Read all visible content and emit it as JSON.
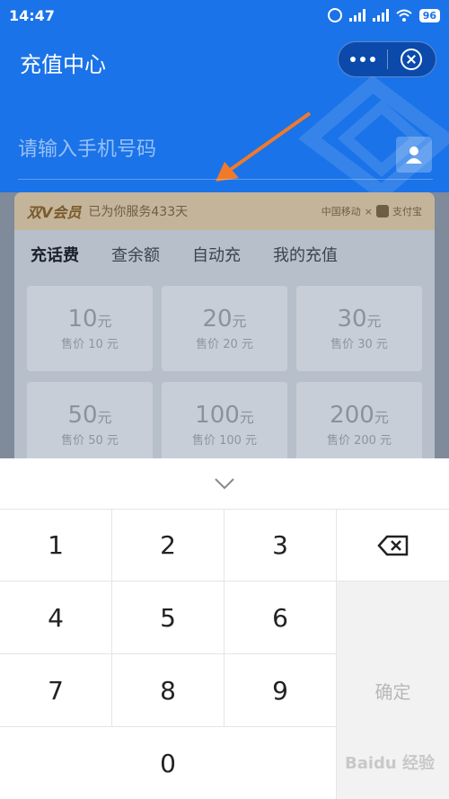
{
  "status_bar": {
    "time": "14:47",
    "battery": "96"
  },
  "header": {
    "title": "充值中心",
    "phone_placeholder": "请输入手机号码"
  },
  "vip": {
    "title": "双V会员",
    "text": "已为你服务433天",
    "brand": "中国移动",
    "separator": "×",
    "partner": "支付宝"
  },
  "tabs": [
    {
      "label": "充话费"
    },
    {
      "label": "查余额"
    },
    {
      "label": "自动充"
    },
    {
      "label": "我的充值"
    }
  ],
  "products": [
    {
      "face": "10",
      "unit": "元",
      "price": "售价 10 元"
    },
    {
      "face": "20",
      "unit": "元",
      "price": "售价 20 元"
    },
    {
      "face": "30",
      "unit": "元",
      "price": "售价 30 元"
    },
    {
      "face": "50",
      "unit": "元",
      "price": "售价 50 元"
    },
    {
      "face": "100",
      "unit": "元",
      "price": "售价 100 元"
    },
    {
      "face": "200",
      "unit": "元",
      "price": "售价 200 元"
    }
  ],
  "keyboard": {
    "keys": [
      "1",
      "2",
      "3",
      "4",
      "5",
      "6",
      "7",
      "8",
      "9",
      "0"
    ],
    "confirm_label": "确定"
  },
  "watermark": "Baidu 经验",
  "colors": {
    "primary": "#1a73e8",
    "arrow": "#f07a2a"
  }
}
